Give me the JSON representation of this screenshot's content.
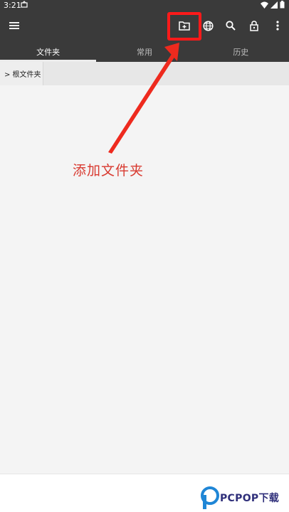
{
  "status_bar": {
    "time": "3:21"
  },
  "tabs": [
    {
      "label": "文件夹",
      "active": true
    },
    {
      "label": "常用",
      "active": false
    },
    {
      "label": "历史",
      "active": false
    }
  ],
  "breadcrumb": {
    "label": "> 根文件夹"
  },
  "annotation": {
    "text": "添加文件夹",
    "color": "#d83a30"
  },
  "watermark": {
    "brand": "PCPOP下载"
  },
  "colors": {
    "toolbar": "#3a3a3a",
    "highlight": "#ff1a1a",
    "background": "#f4f4f4"
  },
  "icons": [
    "menu-icon",
    "new-folder-icon",
    "globe-icon",
    "search-icon",
    "lock-icon",
    "more-vert-icon"
  ]
}
